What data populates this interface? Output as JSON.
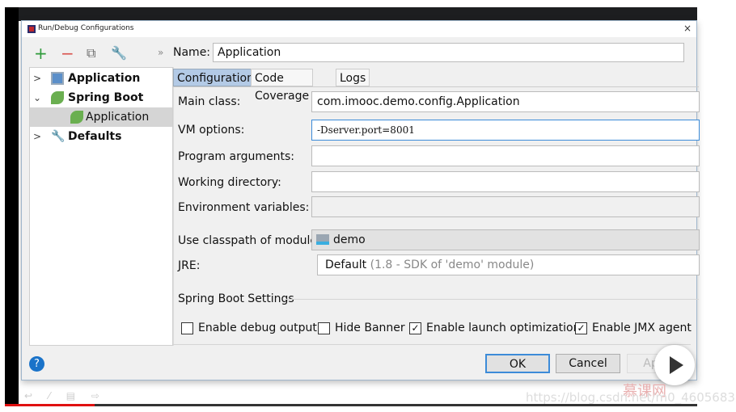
{
  "window": {
    "title": "Run/Debug Configurations",
    "close": "×"
  },
  "toolbar": {
    "add": "+",
    "remove": "−",
    "copy": "⧉",
    "edit": "🔧",
    "more": "»"
  },
  "tree": [
    {
      "label": "Application",
      "expanded": false,
      "level": 0
    },
    {
      "label": "Spring Boot",
      "expanded": true,
      "level": 0
    },
    {
      "label": "Application",
      "level": 1,
      "selected": true
    },
    {
      "label": "Defaults",
      "expanded": false,
      "level": 0
    }
  ],
  "name": {
    "label": "Name:",
    "value": "Application"
  },
  "tabs": [
    {
      "label": "Configuration",
      "active": true
    },
    {
      "label": "Code Coverage"
    },
    {
      "label": "Logs"
    }
  ],
  "form": {
    "main_class": {
      "label": "Main class:",
      "value": "com.imooc.demo.config.Application"
    },
    "vm_options": {
      "label": "VM options:",
      "value": "-Dserver.port=8001"
    },
    "program_arguments": {
      "label": "Program arguments:",
      "value": ""
    },
    "working_directory": {
      "label": "Working directory:",
      "value": ""
    },
    "environment_variables": {
      "label": "Environment variables:",
      "value": ""
    },
    "classpath_module": {
      "label": "Use classpath of module:",
      "value": "demo"
    },
    "jre": {
      "label": "JRE:",
      "value": "Default",
      "hint": "(1.8 - SDK of 'demo' module)"
    }
  },
  "spring_boot_settings": {
    "title": "Spring Boot Settings",
    "options": [
      {
        "label": "Enable debug output",
        "checked": false
      },
      {
        "label": "Hide Banner",
        "checked": false
      },
      {
        "label": "Enable launch optimization",
        "checked": true
      },
      {
        "label": "Enable JMX agent",
        "checked": true
      }
    ]
  },
  "buttons": {
    "help": "?",
    "ok": "OK",
    "cancel": "Cancel",
    "apply": "Apply"
  },
  "video": {
    "progress": 0.13
  },
  "watermark": {
    "url": "https://blog.csdn.net/m0_46056832",
    "logo": "慕课网"
  },
  "colors": {
    "accent": "#3c8bd8",
    "tab_active": "#b3cae6",
    "progress": "#e01010"
  }
}
